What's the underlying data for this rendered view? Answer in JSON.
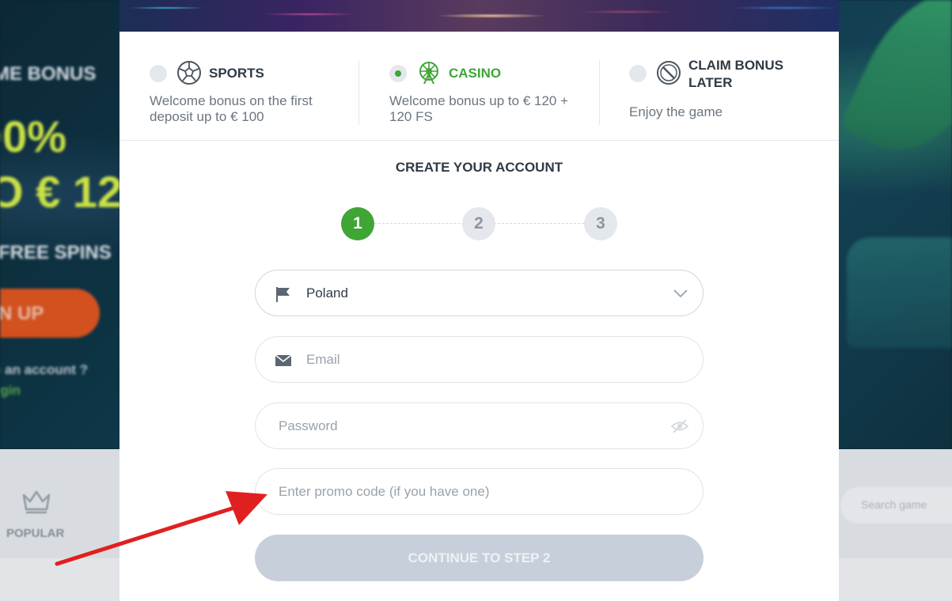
{
  "background": {
    "hero_lines": [
      "ME BONUS",
      "00%",
      "O € 12",
      "FREE SPINS"
    ],
    "signup_button": "N UP",
    "account_prompt": "e an account ?",
    "login_link": "ogin",
    "nav_popular": "POPULAR",
    "search_placeholder": "Search game"
  },
  "bonus_options": [
    {
      "title": "SPORTS",
      "description": "Welcome bonus on the first deposit up to € 100",
      "selected": false,
      "icon": "soccer-ball-icon"
    },
    {
      "title": "CASINO",
      "description": "Welcome bonus up to € 120 + 120 FS",
      "selected": true,
      "icon": "ferris-wheel-icon"
    },
    {
      "title": "CLAIM BONUS LATER",
      "description": "Enjoy the game",
      "selected": false,
      "icon": "prohibited-icon"
    }
  ],
  "form": {
    "title": "CREATE YOUR ACCOUNT",
    "steps": [
      "1",
      "2",
      "3"
    ],
    "active_step": 1,
    "country": {
      "value": "Poland",
      "icon": "flag-icon"
    },
    "email": {
      "placeholder": "Email",
      "icon": "envelope-icon"
    },
    "password": {
      "placeholder": "Password",
      "icon": "eye-slash-icon"
    },
    "promo": {
      "placeholder": "Enter promo code (if you have one)"
    },
    "continue_label": "CONTINUE TO STEP 2"
  },
  "colors": {
    "accent_green": "#3fa535",
    "annotation_red": "#e02020",
    "disabled_button": "#c7d0da"
  }
}
